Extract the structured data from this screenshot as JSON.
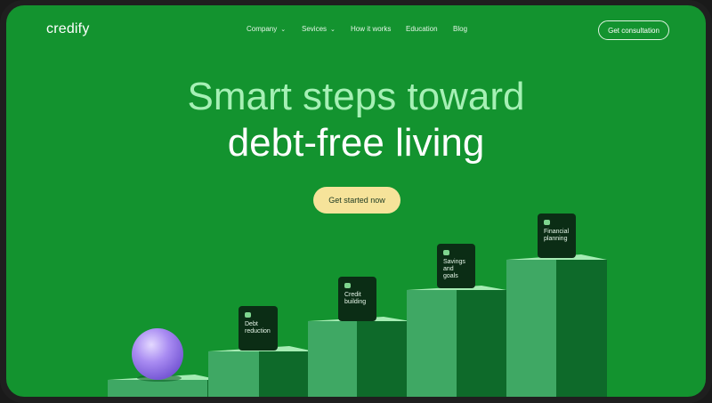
{
  "brand": {
    "name": "credify"
  },
  "nav": {
    "items": [
      {
        "label": "Company",
        "has_dropdown": true
      },
      {
        "label": "Sevices",
        "has_dropdown": true
      },
      {
        "label": "How it works",
        "has_dropdown": false
      },
      {
        "label": "Education",
        "has_dropdown": false
      },
      {
        "label": "Blog",
        "has_dropdown": false
      }
    ],
    "consultation_label": "Get consultation"
  },
  "hero": {
    "line1": "Smart steps toward",
    "line2": "debt-free living",
    "cta_label": "Get started now"
  },
  "steps": [
    {
      "label_line1": "Debt",
      "label_line2": "reduction",
      "icon": "lock-icon"
    },
    {
      "label_line1": "Credit",
      "label_line2": "building",
      "icon": "card-icon"
    },
    {
      "label_line1": "Savings",
      "label_line2": "and goals",
      "icon": "piggy-bank-icon"
    },
    {
      "label_line1": "Financial",
      "label_line2": "planning",
      "icon": "chart-icon"
    }
  ],
  "colors": {
    "background": "#13932f",
    "hero_accent": "#a6f0b5",
    "cta": "#f6e39a",
    "card": "#0b2d15",
    "sphere": "#a98cf2"
  }
}
